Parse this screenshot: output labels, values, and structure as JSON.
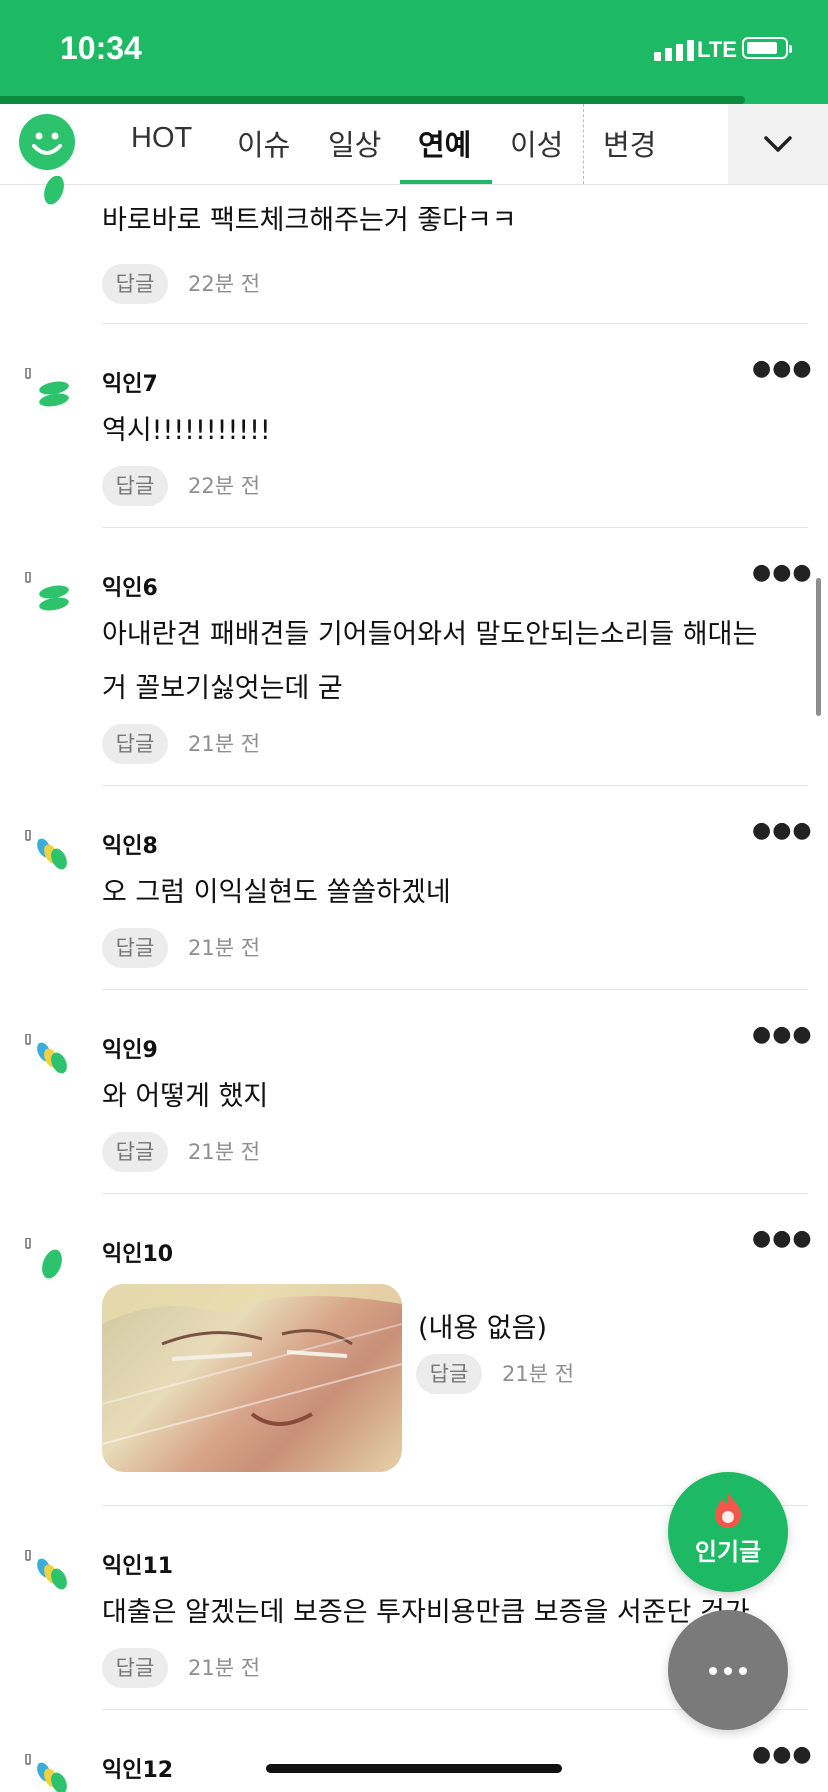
{
  "status_bar": {
    "time": "10:34",
    "network": "LTE",
    "signal_bars": 4,
    "background_color": "#1eb964"
  },
  "page_progress": 0.9,
  "nav": {
    "logo_icon": "smiley-logo-icon",
    "tabs": [
      {
        "label": "HOT",
        "active": false
      },
      {
        "label": "이슈",
        "active": false
      },
      {
        "label": "일상",
        "active": false
      },
      {
        "label": "연예",
        "active": true
      },
      {
        "label": "이성",
        "active": false
      },
      {
        "label": "변경",
        "active": false
      }
    ],
    "expand_icon": "chevron-down-icon",
    "accent_color": "#1eb964"
  },
  "comments": [
    {
      "nickname": "",
      "text": "바로바로 팩트체크해주는거 좋다ㅋㅋ",
      "reply_label": "답글",
      "time": "22분 전",
      "avatar_style": "single-leaf"
    },
    {
      "nickname": "익인7",
      "text": "역시!!!!!!!!!!!",
      "reply_label": "답글",
      "time": "22분 전",
      "avatar_style": "double-leaf"
    },
    {
      "nickname": "익인6",
      "text_lines": [
        "아내란견 패배견들 기어들어와서 말도안되는소리들 해대는",
        "거 꼴보기싫엇는데 굳"
      ],
      "reply_label": "답글",
      "time": "21분 전",
      "avatar_style": "double-leaf"
    },
    {
      "nickname": "익인8",
      "text": "오 그럼 이익실현도 쏠쏠하겠네",
      "reply_label": "답글",
      "time": "21분 전",
      "avatar_style": "triple-leaf"
    },
    {
      "nickname": "익인9",
      "text": "와 어떻게 했지",
      "reply_label": "답글",
      "time": "21분 전",
      "avatar_style": "triple-leaf"
    },
    {
      "nickname": "익인10",
      "text": "(내용 없음)",
      "reply_label": "답글",
      "time": "21분 전",
      "avatar_style": "single-leaf",
      "has_image": true
    },
    {
      "nickname": "익인11",
      "text": "대출은 알겠는데 보증은 투자비용만큼 보증을 서준단 건가",
      "reply_label": "답글",
      "time": "21분 전",
      "avatar_style": "triple-leaf"
    },
    {
      "nickname": "익인12",
      "avatar_style": "triple-leaf"
    }
  ],
  "more_icon": "more-dots-icon",
  "fab": {
    "hot_label": "인기글",
    "hot_icon": "flame-icon",
    "more_icon": "more-dots-icon"
  }
}
